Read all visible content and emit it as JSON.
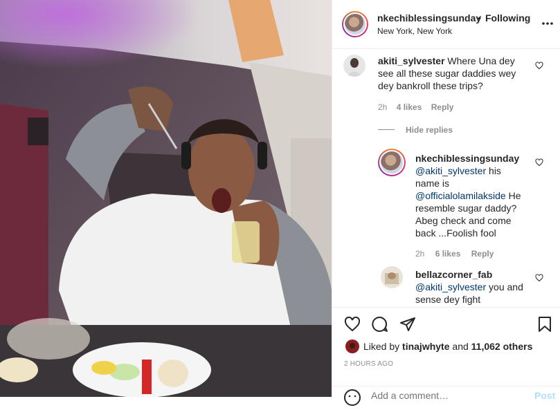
{
  "header": {
    "username": "nkechiblessingsunday",
    "follow_status": "Following",
    "separator": "•",
    "location": "New York, New York",
    "more_label": "..."
  },
  "comments": [
    {
      "username": "akiti_sylvester",
      "text": "Where Una dey see all these sugar daddies wey dey bankroll these trips?",
      "time": "2h",
      "likes": "4 likes",
      "reply_label": "Reply"
    }
  ],
  "hide_replies_label": "Hide replies",
  "replies": [
    {
      "username": "nkechiblessingsunday",
      "mention": "@akiti_sylvester",
      "text_part1": "his name is",
      "mention2": "@officialolamilakside",
      "text_part2": "He resemble sugar daddy? Abeg check and come back ...Foolish fool",
      "time": "2h",
      "likes": "6 likes",
      "reply_label": "Reply"
    },
    {
      "username": "bellazcorner_fab",
      "mention": "@akiti_sylvester",
      "text": "you and sense dey fight"
    }
  ],
  "likes_line": {
    "prefix": "Liked by",
    "user": "tinajwhyte",
    "middle": "and",
    "count": "11,062 others"
  },
  "timestamp": "2 HOURS AGO",
  "comment_box": {
    "placeholder": "Add a comment…",
    "post_label": "Post"
  },
  "colors": {
    "text": "#262626",
    "muted": "#8e8e8e",
    "link": "#00376b",
    "post_disabled": "#b2dffc"
  },
  "icons": [
    "heart-icon",
    "comment-icon",
    "share-icon",
    "bookmark-icon",
    "emoji-icon",
    "more-icon"
  ]
}
